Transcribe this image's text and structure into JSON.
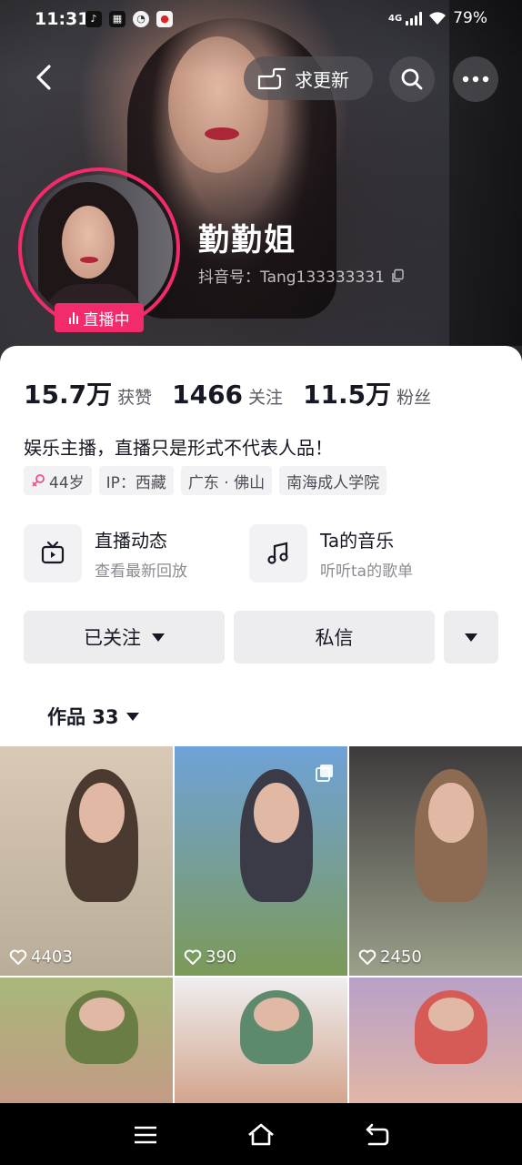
{
  "status_bar": {
    "time": "11:31",
    "network": "4G",
    "battery": "79%",
    "app_icons": [
      "tiktok-icon",
      "qr-code-icon",
      "compass-icon",
      "alert-app-icon"
    ]
  },
  "nav": {
    "update_label": "求更新"
  },
  "profile": {
    "name": "勤勤姐",
    "douyin_id": "抖音号：Tang133333331",
    "live_label": "直播中"
  },
  "stats": [
    {
      "value": "15.7万",
      "label": "获赞"
    },
    {
      "value": "1466",
      "label": "关注"
    },
    {
      "value": "11.5万",
      "label": "粉丝"
    }
  ],
  "bio": "娱乐主播，直播只是形式不代表人品！",
  "tags": [
    {
      "label": "44岁",
      "icon": "female-icon"
    },
    {
      "label": "IP：西藏"
    },
    {
      "label": "广东 · 佛山"
    },
    {
      "label": "南海成人学院"
    }
  ],
  "shortcuts": [
    {
      "title": "直播动态",
      "subtitle": "查看最新回放",
      "icon": "tv-icon"
    },
    {
      "title": "Ta的音乐",
      "subtitle": "听听ta的歌单",
      "icon": "music-note-icon"
    }
  ],
  "actions": {
    "follow_label": "已关注",
    "message_label": "私信"
  },
  "works_tab": {
    "label": "作品 33"
  },
  "videos": [
    {
      "likes": "4403",
      "colors": [
        "#d9c9b6",
        "#b9ad9a",
        "#4a3a30"
      ]
    },
    {
      "likes": "390",
      "colors": [
        "#6fa2d8",
        "#7c9a58",
        "#3a3b46"
      ],
      "multi_image": true
    },
    {
      "likes": "2450",
      "colors": [
        "#3e3a3c",
        "#9aa08a",
        "#8c6b52"
      ]
    },
    {
      "likes": "",
      "colors": [
        "#a7b879",
        "#c49a85",
        "#6a7d45"
      ]
    },
    {
      "likes": "",
      "colors": [
        "#efeef0",
        "#d3a48c",
        "#5d8a6c"
      ]
    },
    {
      "likes": "",
      "colors": [
        "#b9a0c8",
        "#e0b6a6",
        "#d65a55"
      ]
    }
  ]
}
